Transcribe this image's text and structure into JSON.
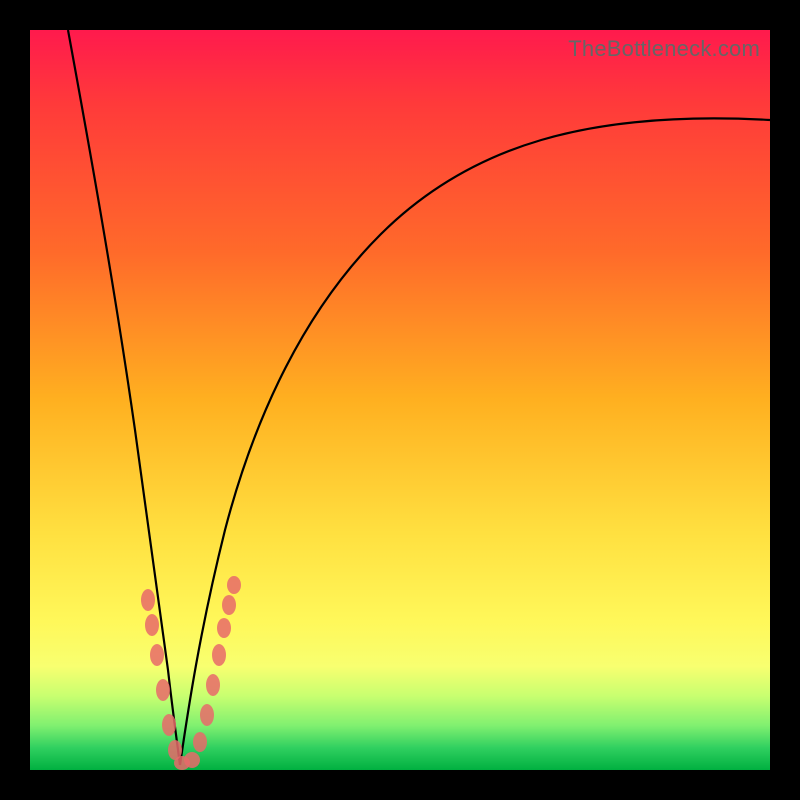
{
  "watermark": "TheBottleneck.com",
  "colors": {
    "frame": "#000000",
    "gradient_top": "#ff1a4d",
    "gradient_mid1": "#ff6a2a",
    "gradient_mid2": "#ffe040",
    "gradient_bottom": "#00b040",
    "curve": "#000000",
    "marker": "#e76a6a"
  },
  "chart_data": {
    "type": "line",
    "title": "",
    "xlabel": "",
    "ylabel": "",
    "xlim": [
      0,
      100
    ],
    "ylim": [
      0,
      100
    ],
    "description": "Two smooth black curves descending from the top edge into a narrow V-shaped cusp near x≈20, y≈0, then one branch rises asymptotically toward the right edge.",
    "series": [
      {
        "name": "left-branch",
        "x": [
          5,
          7,
          9,
          11,
          13,
          15,
          16,
          17,
          18,
          19
        ],
        "y": [
          100,
          82,
          66,
          50,
          36,
          22,
          16,
          10,
          5,
          0
        ]
      },
      {
        "name": "right-branch",
        "x": [
          19,
          20,
          21,
          22,
          24,
          26,
          29,
          33,
          38,
          45,
          55,
          68,
          82,
          100
        ],
        "y": [
          0,
          4,
          10,
          17,
          28,
          38,
          48,
          57,
          65,
          72,
          78,
          83,
          86,
          88
        ]
      }
    ],
    "markers": {
      "name": "sample-points",
      "x": [
        15.5,
        15.8,
        16.3,
        17.0,
        17.8,
        18.5,
        19.2,
        20.0,
        20.8,
        21.5,
        22.0,
        22.4,
        22.7,
        23.0,
        23.3
      ],
      "y": [
        22,
        19,
        15,
        10,
        5,
        2,
        0,
        0,
        2,
        6,
        11,
        15,
        18,
        21,
        24
      ]
    }
  }
}
